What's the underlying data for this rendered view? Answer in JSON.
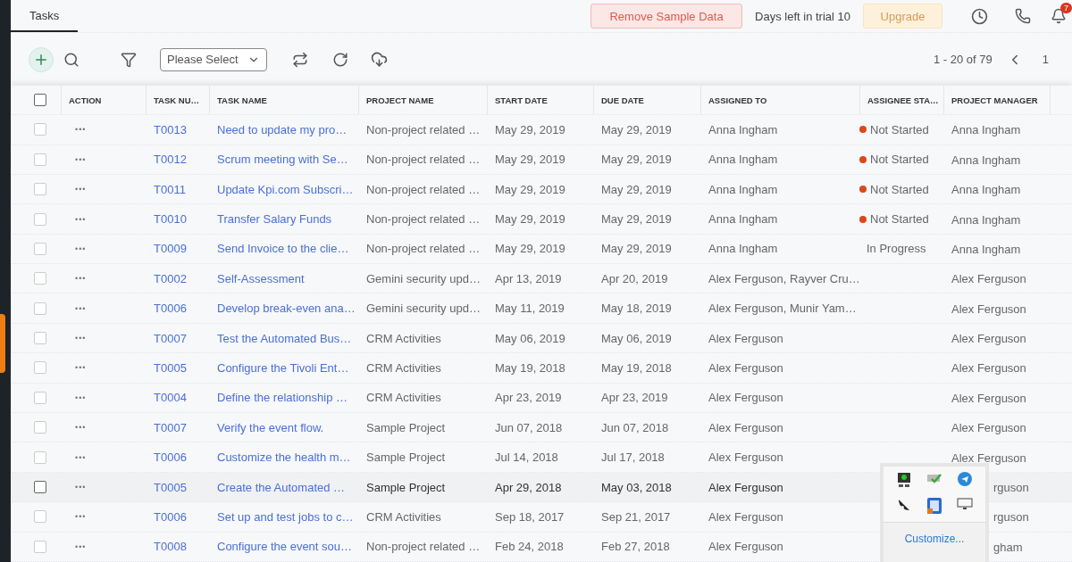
{
  "tabs": [
    {
      "label": "Tasks",
      "selected": true
    }
  ],
  "header_actions": {
    "remove_button": "Remove Sample Data",
    "trial_text": "Days left in trial 10",
    "upgrade_button": "Upgrade",
    "notification_count": "7"
  },
  "toolbar": {
    "select": {
      "placeholder": "Please Select"
    },
    "pagination": {
      "range": "1 - 20 of 79",
      "page": "1"
    }
  },
  "table": {
    "select_all_checked": false,
    "columns": [
      "ACTION",
      "TASK NU…",
      "TASK NAME",
      "PROJECT NAME",
      "START DATE",
      "DUE DATE",
      "ASSIGNED TO",
      "ASSIGNEE STA…",
      "PROJECT MANAGER"
    ],
    "rows": [
      {
        "checked": false,
        "highlighted": false,
        "action": "•••",
        "number": "T0013",
        "name": "Need to update my pro…",
        "project": "Non-project related …",
        "start": "May 29, 2019",
        "due": "May 29, 2019",
        "assigned": "Anna Ingham",
        "status": "Not Started",
        "color": "#e0461c",
        "manager": "Anna Ingham"
      },
      {
        "checked": false,
        "highlighted": false,
        "action": "•••",
        "number": "T0012",
        "name": "Scrum meeting with Se…",
        "project": "Non-project related …",
        "start": "May 29, 2019",
        "due": "May 29, 2019",
        "assigned": "Anna Ingham",
        "status": "Not Started",
        "color": "#e0461c",
        "manager": "Anna Ingham"
      },
      {
        "checked": false,
        "highlighted": false,
        "action": "•••",
        "number": "T0011",
        "name": "Update Kpi.com Subscri…",
        "project": "Non-project related …",
        "start": "May 29, 2019",
        "due": "May 29, 2019",
        "assigned": "Anna Ingham",
        "status": "Not Started",
        "color": "#e0461c",
        "manager": "Anna Ingham"
      },
      {
        "checked": false,
        "highlighted": false,
        "action": "•••",
        "number": "T0010",
        "name": "Transfer Salary Funds",
        "project": "Non-project related …",
        "start": "May 29, 2019",
        "due": "May 29, 2019",
        "assigned": "Anna Ingham",
        "status": "Not Started",
        "color": "#e0461c",
        "manager": "Anna Ingham"
      },
      {
        "checked": false,
        "highlighted": false,
        "action": "•••",
        "number": "T0009",
        "name": "Send Invoice to the clie…",
        "project": "Non-project related …",
        "start": "May 29, 2019",
        "due": "May 29, 2019",
        "assigned": "Anna Ingham",
        "status": "In Progress",
        "manager": "Anna Ingham"
      },
      {
        "checked": false,
        "highlighted": false,
        "action": "•••",
        "number": "T0002",
        "name": "Self-Assessment",
        "project": "Gemini security upd…",
        "start": "Apr 13, 2019",
        "due": "Apr 20, 2019",
        "assigned": "Alex Ferguson, Rayver Cru…",
        "manager": "Alex Ferguson"
      },
      {
        "checked": false,
        "highlighted": false,
        "action": "•••",
        "number": "T0006",
        "name": "Develop break-even ana…",
        "project": "Gemini security upd…",
        "start": "May 11, 2019",
        "due": "May 18, 2019",
        "assigned": "Alex Ferguson, Munir Yam…",
        "manager": "Alex Ferguson"
      },
      {
        "checked": false,
        "highlighted": false,
        "action": "•••",
        "number": "T0007",
        "name": "Test the Automated Bus…",
        "project": "CRM Activities",
        "start": "May 06, 2019",
        "due": "May 06, 2019",
        "assigned": "Alex Ferguson",
        "manager": "Alex Ferguson"
      },
      {
        "checked": false,
        "highlighted": false,
        "action": "•••",
        "number": "T0005",
        "name": "Configure the Tivoli Ent…",
        "project": "CRM Activities",
        "start": "May 19, 2018",
        "due": "May 19, 2018",
        "assigned": "Alex Ferguson",
        "manager": "Alex Ferguson"
      },
      {
        "checked": false,
        "highlighted": false,
        "action": "•••",
        "number": "T0004",
        "name": "Define the relationship …",
        "project": "CRM Activities",
        "start": "Apr 23, 2019",
        "due": "Apr 23, 2019",
        "assigned": "Alex Ferguson",
        "manager": "Alex Ferguson"
      },
      {
        "checked": false,
        "highlighted": false,
        "action": "•••",
        "number": "T0007",
        "name": "Verify the event flow.",
        "project": "Sample Project",
        "start": "Jun 07, 2018",
        "due": "Jun 07, 2018",
        "assigned": "Alex Ferguson",
        "manager": "Alex Ferguson"
      },
      {
        "checked": false,
        "highlighted": false,
        "action": "•••",
        "number": "T0006",
        "name": "Customize the health m…",
        "project": "Sample Project",
        "start": "Jul 14, 2018",
        "due": "Jul 17, 2018",
        "assigned": "Alex Ferguson",
        "manager": "Alex Ferguson"
      },
      {
        "checked": false,
        "highlighted": true,
        "action": "•••",
        "number": "T0005",
        "name": "Create the Automated …",
        "project": "Sample Project",
        "start": "Apr 29, 2018",
        "due": "May 03, 2018",
        "assigned": "Alex Ferguson",
        "manager": "rguson"
      },
      {
        "checked": false,
        "highlighted": false,
        "action": "•••",
        "number": "T0006",
        "name": "Set up and test jobs to c…",
        "project": "CRM Activities",
        "start": "Sep 18, 2017",
        "due": "Sep 21, 2017",
        "assigned": "Alex Ferguson",
        "manager": "rguson"
      },
      {
        "checked": false,
        "highlighted": false,
        "action": "•••",
        "number": "T0008",
        "name": "Configure the event sou…",
        "project": "Non-project related …",
        "start": "Feb 24, 2018",
        "due": "Feb 27, 2018",
        "assigned": "Alex Ferguson",
        "manager": "gham"
      }
    ]
  },
  "tray_popup": {
    "link": "Customize..."
  }
}
